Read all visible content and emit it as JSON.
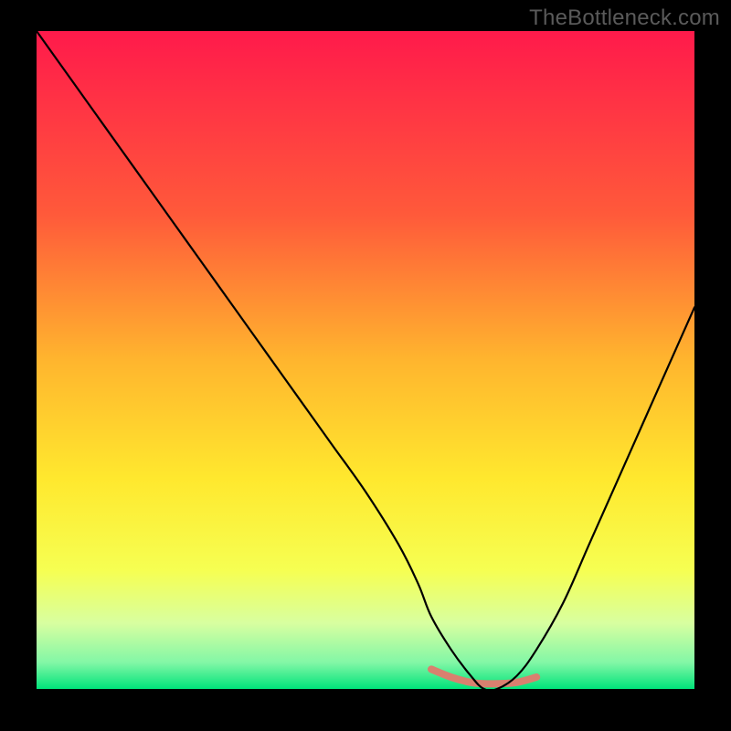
{
  "watermark": "TheBottleneck.com",
  "chart_data": {
    "type": "line",
    "title": "",
    "xlabel": "",
    "ylabel": "",
    "xlim": [
      0,
      100
    ],
    "ylim": [
      0,
      100
    ],
    "grid": false,
    "legend": false,
    "background_gradient": {
      "stops": [
        {
          "offset": 0.0,
          "color": "#ff1a4b"
        },
        {
          "offset": 0.28,
          "color": "#ff5a3a"
        },
        {
          "offset": 0.5,
          "color": "#ffb52e"
        },
        {
          "offset": 0.68,
          "color": "#ffe82e"
        },
        {
          "offset": 0.82,
          "color": "#f6ff52"
        },
        {
          "offset": 0.9,
          "color": "#d8ffa0"
        },
        {
          "offset": 0.96,
          "color": "#82f7a6"
        },
        {
          "offset": 1.0,
          "color": "#00e37a"
        }
      ]
    },
    "series": [
      {
        "name": "bottleneck-curve",
        "x": [
          0,
          5,
          10,
          15,
          20,
          25,
          30,
          35,
          40,
          45,
          50,
          55,
          58,
          60,
          63,
          66,
          68,
          70,
          73,
          76,
          80,
          84,
          88,
          92,
          96,
          100
        ],
        "values": [
          100,
          93,
          86,
          79,
          72,
          65,
          58,
          51,
          44,
          37,
          30,
          22,
          16,
          11,
          6,
          2,
          0,
          0,
          2,
          6,
          13,
          22,
          31,
          40,
          49,
          58
        ]
      }
    ],
    "highlight_segment": {
      "name": "optimal-range",
      "color": "#d9806f",
      "x": [
        60,
        63,
        66,
        68,
        70,
        73,
        76
      ],
      "values": [
        3,
        1.8,
        1,
        0.8,
        0.8,
        1,
        1.8
      ]
    }
  }
}
